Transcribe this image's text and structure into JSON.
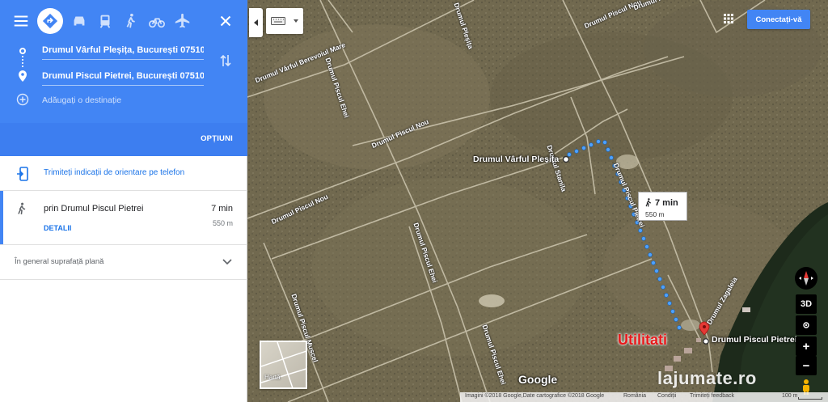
{
  "panel": {
    "modes": [
      {
        "name": "menu-icon"
      },
      {
        "name": "directions-icon"
      },
      {
        "name": "car-icon"
      },
      {
        "name": "transit-icon"
      },
      {
        "name": "walk-icon"
      },
      {
        "name": "bicycle-icon"
      },
      {
        "name": "flight-icon"
      },
      {
        "name": "close-icon"
      }
    ],
    "origin": "Drumul Vârful Pleșița, București 07510",
    "destination": "Drumul Piscul Pietrei, București 07510",
    "add_destination": "Adăugați o destinație",
    "options_label": "OPȚIUNI",
    "send_to_phone": "Trimiteți indicații de orientare pe telefon",
    "route": {
      "via": "prin Drumul Piscul Pietrei",
      "time": "7 min",
      "distance": "550 m",
      "details": "DETALII"
    },
    "terrain_note": "În general suprafață plană"
  },
  "map": {
    "signin_label": "Conectați-vă",
    "place_origin": "Drumul Vârful Pleșița",
    "place_destination": "Drumul Piscul Pietrei",
    "walk_time": "7 min",
    "walk_distance": "550 m",
    "utilitati": "Utilitati",
    "map_type_label": "Hartă",
    "google_logo": "Google",
    "watermark": "lajumate.ro",
    "controls": {
      "tilt": "3D",
      "zoom_in": "+",
      "zoom_out": "−"
    },
    "road_labels": {
      "berevoiu": "Drumul Vârful Berevoiul Mare",
      "piscul_nou_1": "Drumul Piscul Nou",
      "piscul_nou_2": "Drumul Piscul Nou",
      "piscul_nou_3": "Drumul Piscul Nou",
      "ehei_1": "Drumul Piscul Ehei",
      "ehei_2": "Drumul Piscul Ehei",
      "ehei_3": "Drumul Piscul Ehei",
      "plesita": "Drumul Pleșița",
      "stanila": "Drumul Stanila",
      "muscel": "Drumul Piscul Muscel",
      "piscul_pietrei": "Drumul Piscul Pietrei",
      "zagalei": "Drumul Zagaleia",
      "piscul": "Drumul Piscul"
    },
    "footer": {
      "imagery": "Imagini ©2018 Google,Date cartografice ©2018 Google",
      "country": "România",
      "terms": "Condiții",
      "feedback": "Trimiteți feedback",
      "scale": "100 m"
    }
  }
}
